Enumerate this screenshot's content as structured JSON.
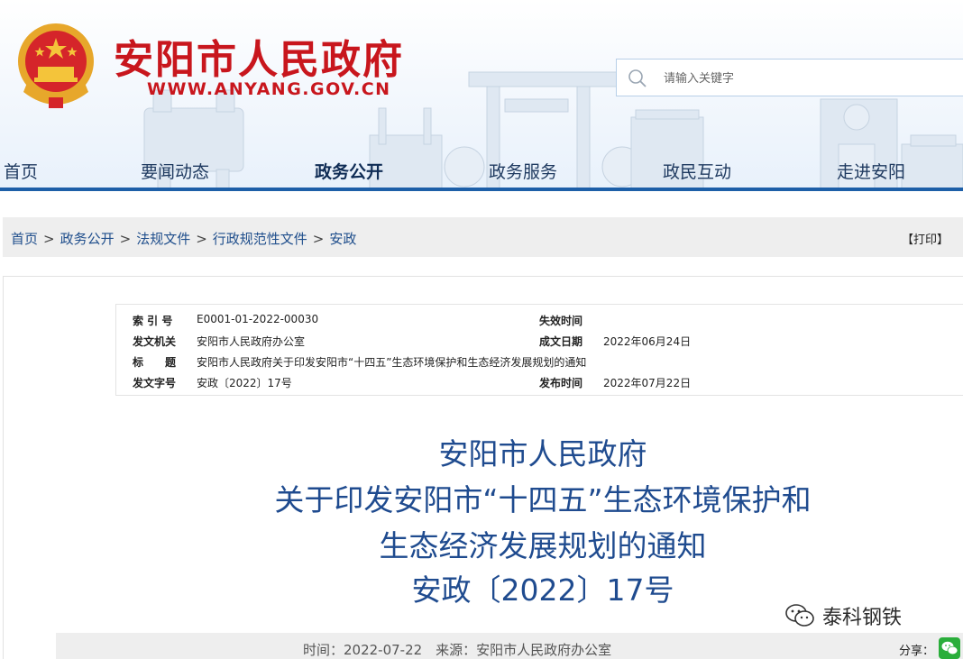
{
  "header": {
    "site_title": "安阳市人民政府",
    "site_url": "WWW.ANYANG.GOV.CN",
    "brand_color": "#c8161d",
    "search": {
      "placeholder": "请输入关键字"
    }
  },
  "nav": {
    "items": [
      {
        "label": "首页"
      },
      {
        "label": "要闻动态"
      },
      {
        "label": "政务公开",
        "active": true
      },
      {
        "label": "政务服务"
      },
      {
        "label": "政民互动"
      },
      {
        "label": "走进安阳"
      }
    ],
    "accent_color": "#1d5fa8"
  },
  "breadcrumb": {
    "items": [
      "首页",
      "政务公开",
      "法规文件",
      "行政规范性文件",
      "安政"
    ],
    "separator": ">",
    "print_label": "【打印】"
  },
  "meta": {
    "index_label": "索 引 号",
    "index_value": "E0001-01-2022-00030",
    "expire_label": "失效时间",
    "expire_value": "",
    "issuer_label": "发文机关",
    "issuer_value": "安阳市人民政府办公室",
    "created_label": "成文日期",
    "created_value": "2022年06月24日",
    "subject_label": "标　　题",
    "subject_value": "安阳市人民政府关于印发安阳市“十四五”生态环境保护和生态经济发展规划的通知",
    "docno_label": "发文字号",
    "docno_value": "安政〔2022〕17号",
    "published_label": "发布时间",
    "published_value": "2022年07月22日"
  },
  "document": {
    "title_lines": [
      "安阳市人民政府",
      "关于印发安阳市“十四五”生态环境保护和",
      "生态经济发展规划的通知",
      "安政〔2022〕17号"
    ],
    "title_color": "#1f4b8f"
  },
  "watermark": {
    "text": "泰科钢铁"
  },
  "info": {
    "text": "时间：2022-07-22　来源：安阳市人民政府办公室",
    "share_label": "分享："
  }
}
